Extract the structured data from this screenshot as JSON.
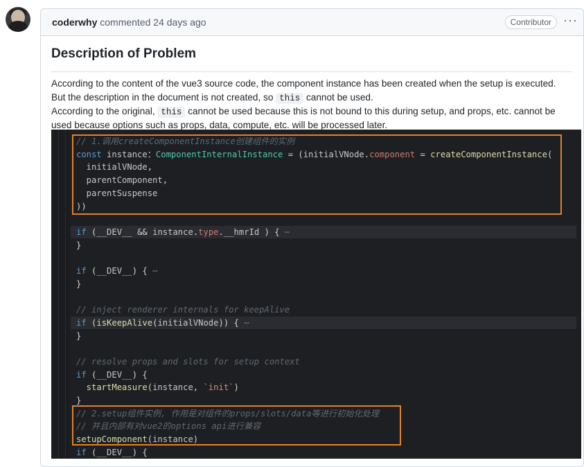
{
  "comment": {
    "author": "coderwhy",
    "action": "commented 24 days ago",
    "badge": "Contributor",
    "more": "···",
    "title": "Description of Problem",
    "paragraphs": [
      {
        "before": "According to the content of the vue3 source code, the component instance has been created when the setup is executed.",
        "code": "",
        "after": ""
      },
      {
        "before": "But the description in the document is not created, so",
        "code": "this",
        "after": "cannot be used."
      },
      {
        "before": "According to the original,",
        "code": "this",
        "after": "cannot be used because this is not bound to this during setup, and props, etc. cannot be"
      },
      {
        "before": "used because options such as props, data, compute, etc. will be processed later.",
        "code": "",
        "after": ""
      }
    ]
  },
  "code": {
    "lines": [
      [
        [
          "cm",
          "// 1.调用createComponentInstance创建组件的实例"
        ]
      ],
      [
        [
          "kw",
          "const "
        ],
        [
          "vr",
          "instance"
        ],
        [
          "",
          "："
        ],
        [
          "ty",
          "ComponentInternalInstance"
        ],
        [
          "",
          " = ("
        ],
        [
          "vr",
          "initialVNode"
        ],
        [
          "",
          "."
        ],
        [
          "pr",
          "component"
        ],
        [
          "",
          " = "
        ],
        [
          "fn",
          "createComponentInstance"
        ],
        [
          "",
          "("
        ]
      ],
      [
        [
          "vr",
          "  initialVNode"
        ],
        [
          "",
          ","
        ]
      ],
      [
        [
          "vr",
          "  parentComponent"
        ],
        [
          "",
          ","
        ]
      ],
      [
        [
          "vr",
          "  parentSuspense"
        ]
      ],
      [
        [
          "",
          "))"
        ]
      ],
      [
        [
          "",
          ""
        ]
      ],
      [
        [
          "kw",
          "if"
        ],
        [
          "",
          " ("
        ],
        [
          "vr",
          "__DEV__"
        ],
        [
          "",
          " && "
        ],
        [
          "vr",
          "instance"
        ],
        [
          "",
          "."
        ],
        [
          "pr",
          "type"
        ],
        [
          "",
          "."
        ],
        [
          "vr",
          "__hmrId"
        ],
        [
          "",
          " ) { "
        ],
        [
          "fold",
          "⋯"
        ]
      ],
      [
        [
          "",
          "}"
        ]
      ],
      [
        [
          "",
          ""
        ]
      ],
      [
        [
          "kw",
          "if"
        ],
        [
          "",
          " ("
        ],
        [
          "vr",
          "__DEV__"
        ],
        [
          "",
          ") { "
        ],
        [
          "fold",
          "⋯"
        ]
      ],
      [
        [
          "",
          "}"
        ]
      ],
      [
        [
          "",
          ""
        ]
      ],
      [
        [
          "cm",
          "// inject renderer internals for keepAlive"
        ]
      ],
      [
        [
          "kw",
          "if"
        ],
        [
          "",
          " ("
        ],
        [
          "fn",
          "isKeepAlive"
        ],
        [
          "",
          "("
        ],
        [
          "vr",
          "initialVNode"
        ],
        [
          "",
          ")) { "
        ],
        [
          "fold",
          "⋯"
        ]
      ],
      [
        [
          "",
          "}"
        ]
      ],
      [
        [
          "",
          ""
        ]
      ],
      [
        [
          "cm",
          "// resolve props and slots for setup context"
        ]
      ],
      [
        [
          "kw",
          "if"
        ],
        [
          "",
          " ("
        ],
        [
          "vr",
          "__DEV__"
        ],
        [
          "",
          ") {"
        ]
      ],
      [
        [
          "fn",
          "  startMeasure"
        ],
        [
          "",
          "("
        ],
        [
          "vr",
          "instance"
        ],
        [
          "",
          ", "
        ],
        [
          "st",
          "`init`"
        ],
        [
          "",
          ")"
        ]
      ],
      [
        [
          "",
          "}"
        ]
      ],
      [
        [
          "cm",
          "// 2.setup组件实例, 作用是对组件的props/slots/data等进行初始化处理"
        ]
      ],
      [
        [
          "cm",
          "// 并且内部有对vue2的options api进行兼容"
        ]
      ],
      [
        [
          "fn",
          "setupComponent"
        ],
        [
          "",
          "("
        ],
        [
          "vr",
          "instance"
        ],
        [
          "",
          ")"
        ]
      ],
      [
        [
          "kw",
          "if"
        ],
        [
          "",
          " ("
        ],
        [
          "vr",
          "__DEV__"
        ],
        [
          "",
          ") {"
        ]
      ]
    ]
  }
}
